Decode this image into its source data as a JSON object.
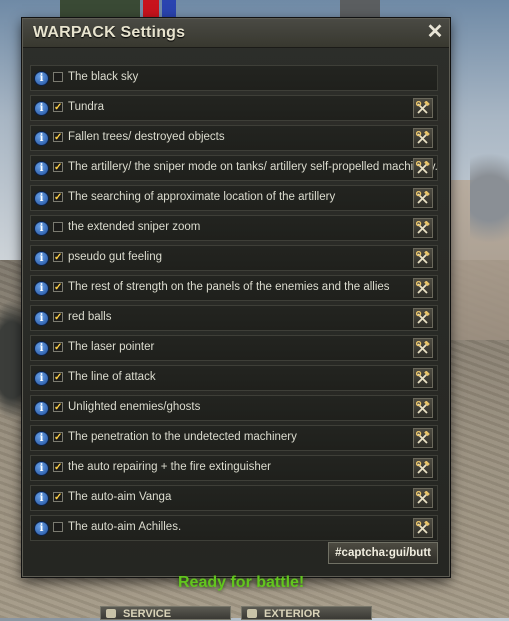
{
  "window": {
    "title": "WARPACK Settings",
    "close_icon": "close-icon"
  },
  "settings": [
    {
      "label": "The black sky",
      "checked": false,
      "has_config": false
    },
    {
      "label": "Tundra",
      "checked": true,
      "has_config": true
    },
    {
      "label": "Fallen trees/ destroyed objects",
      "checked": true,
      "has_config": true
    },
    {
      "label": "The artillery/ the sniper mode on tanks/ artillery self-propelled machinery.",
      "checked": true,
      "has_config": true
    },
    {
      "label": "The searching of approximate location of the artillery",
      "checked": true,
      "has_config": true
    },
    {
      "label": "the extended sniper zoom",
      "checked": false,
      "has_config": true
    },
    {
      "label": "pseudo gut feeling",
      "checked": true,
      "has_config": true
    },
    {
      "label": "The rest of strength on the panels of the enemies and the allies",
      "checked": true,
      "has_config": true
    },
    {
      "label": "red balls",
      "checked": true,
      "has_config": true
    },
    {
      "label": "The laser pointer",
      "checked": true,
      "has_config": true
    },
    {
      "label": "The line of attack",
      "checked": true,
      "has_config": true
    },
    {
      "label": "Unlighted enemies/ghosts",
      "checked": true,
      "has_config": true
    },
    {
      "label": "The penetration to the undetected machinery",
      "checked": true,
      "has_config": true
    },
    {
      "label": "the auto repairing + the fire extinguisher",
      "checked": true,
      "has_config": true
    },
    {
      "label": "The auto-aim Vanga",
      "checked": true,
      "has_config": true
    },
    {
      "label": "The auto-aim Achilles.",
      "checked": false,
      "has_config": true
    }
  ],
  "footer": {
    "captcha_button": "#captcha:gui/butt"
  },
  "background": {
    "ready_text": "Ready for battle!",
    "service_button": "SERVICE",
    "exterior_button": "EXTERIOR"
  },
  "icons": {
    "info": "info-icon",
    "config": "hammer-wrench-icon"
  },
  "colors": {
    "checkmark": "#ffd24a",
    "info_blue": "#2f6fd0",
    "ready_green": "#62c61e"
  }
}
